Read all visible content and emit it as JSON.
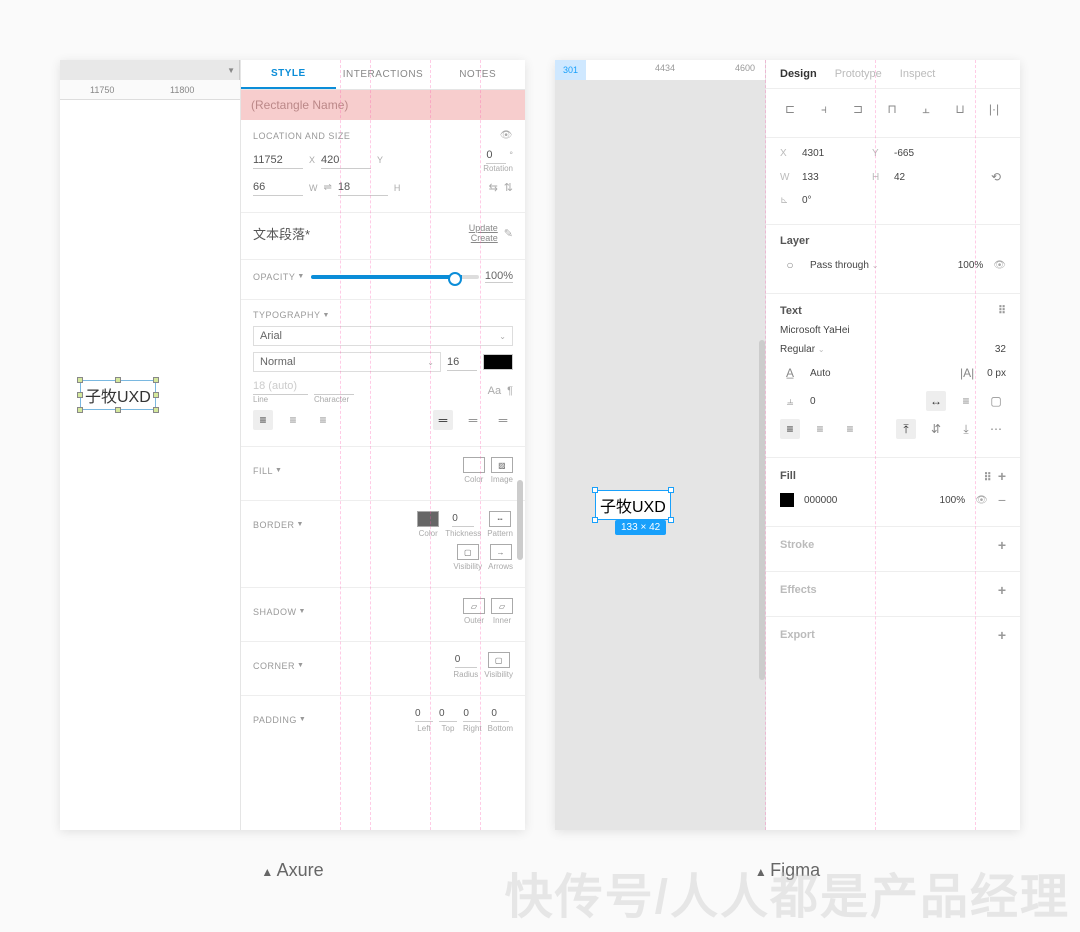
{
  "captions": {
    "left": "Axure",
    "right": "Figma"
  },
  "watermark": "快传号/人人都是产品经理",
  "axure": {
    "ruler": {
      "t1": "11750",
      "t2": "11800"
    },
    "selected_text": "子牧UXD",
    "tabs": {
      "style": "STYLE",
      "interactions": "INTERACTIONS",
      "notes": "NOTES"
    },
    "name_placeholder": "(Rectangle Name)",
    "location": {
      "title": "LOCATION AND SIZE",
      "x": "11752",
      "xl": "X",
      "y": "420",
      "yl": "Y",
      "rot": "0",
      "rotl": "Rotation",
      "w": "66",
      "wl": "W",
      "h": "18",
      "hl": "H"
    },
    "style_name": "文本段落*",
    "style_actions": {
      "update": "Update",
      "create": "Create"
    },
    "opacity": {
      "title": "OPACITY",
      "value": "100%"
    },
    "typography": {
      "title": "TYPOGRAPHY",
      "font": "Arial",
      "weight": "Normal",
      "size": "16",
      "line": "18 (auto)",
      "line_label": "Line",
      "char_label": "Character"
    },
    "fill": {
      "title": "FILL",
      "color": "Color",
      "image": "Image"
    },
    "border": {
      "title": "BORDER",
      "color": "Color",
      "thickness_val": "0",
      "thickness": "Thickness",
      "pattern": "Pattern",
      "visibility": "Visibility",
      "arrows": "Arrows"
    },
    "shadow": {
      "title": "SHADOW",
      "outer": "Outer",
      "inner": "Inner"
    },
    "corner": {
      "title": "CORNER",
      "radius_val": "0",
      "radius": "Radius",
      "visibility": "Visibility"
    },
    "padding": {
      "title": "PADDING",
      "l": "0",
      "ll": "Left",
      "t": "0",
      "tl": "Top",
      "r": "0",
      "rl": "Right",
      "b": "0",
      "bl": "Bottom"
    }
  },
  "figma": {
    "ruler": {
      "sel": "301",
      "t1": "4434",
      "t2": "4600"
    },
    "selected_text": "子牧UXD",
    "dim_badge": "133 × 42",
    "tabs": {
      "design": "Design",
      "prototype": "Prototype",
      "inspect": "Inspect"
    },
    "frame": {
      "x": "4301",
      "xl": "X",
      "y": "-665",
      "yl": "Y",
      "w": "133",
      "wl": "W",
      "h": "42",
      "hl": "H",
      "rot": "0°"
    },
    "layer": {
      "title": "Layer",
      "blend": "Pass through",
      "opacity": "100%"
    },
    "text": {
      "title": "Text",
      "font": "Microsoft YaHei",
      "weight": "Regular",
      "size": "32",
      "lh_label": "Auto",
      "ls_label": "0 px",
      "para": "0"
    },
    "fill": {
      "title": "Fill",
      "hex": "000000",
      "opacity": "100%"
    },
    "stroke": {
      "title": "Stroke"
    },
    "effects": {
      "title": "Effects"
    },
    "export": {
      "title": "Export"
    }
  }
}
